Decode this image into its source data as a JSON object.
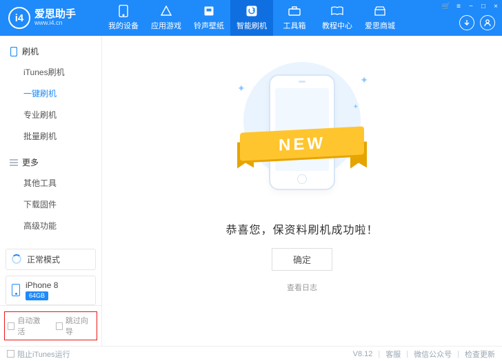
{
  "brand": {
    "logo_text": "i4",
    "cn": "爱思助手",
    "en": "www.i4.cn"
  },
  "win": {
    "cart": "🛒",
    "menu": "≡",
    "min": "−",
    "max": "□",
    "close": "×"
  },
  "tabs": [
    {
      "id": "device",
      "label": "我的设备"
    },
    {
      "id": "appgame",
      "label": "应用游戏"
    },
    {
      "id": "ringwall",
      "label": "铃声壁纸"
    },
    {
      "id": "flash",
      "label": "智能刷机",
      "active": true
    },
    {
      "id": "toolbox",
      "label": "工具箱"
    },
    {
      "id": "tutorial",
      "label": "教程中心"
    },
    {
      "id": "mall",
      "label": "爱思商城"
    }
  ],
  "sidebar": {
    "groups": [
      {
        "title": "刷机",
        "icon": "phone",
        "items": [
          {
            "label": "iTunes刷机"
          },
          {
            "label": "一键刷机",
            "active": true
          },
          {
            "label": "专业刷机"
          },
          {
            "label": "批量刷机"
          }
        ]
      },
      {
        "title": "更多",
        "icon": "list",
        "items": [
          {
            "label": "其他工具"
          },
          {
            "label": "下载固件"
          },
          {
            "label": "高级功能"
          }
        ]
      }
    ],
    "mode": {
      "label": "正常模式"
    },
    "device": {
      "name": "iPhone 8",
      "storage": "64GB"
    },
    "bottom_checks": [
      {
        "label": "自动激活"
      },
      {
        "label": "跳过向导"
      }
    ]
  },
  "main": {
    "ribbon": "NEW",
    "success": "恭喜您，保资料刷机成功啦！",
    "ok": "确定",
    "view_log": "查看日志"
  },
  "footer": {
    "block_itunes": "阻止iTunes运行",
    "version": "V8.12",
    "support": "客服",
    "wechat": "微信公众号",
    "update": "检查更新"
  }
}
